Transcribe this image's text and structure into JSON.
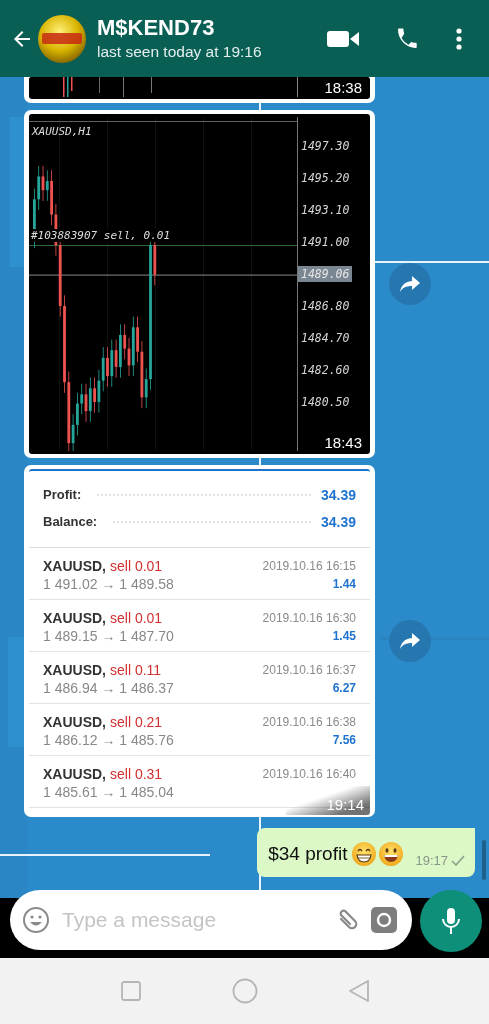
{
  "header": {
    "title": "M$KEND73",
    "status": "last seen today at 19:16"
  },
  "messages": [
    {
      "kind": "chart_tail",
      "time": "18:38"
    },
    {
      "kind": "chart",
      "time": "18:43",
      "forward": true,
      "chart": {
        "title": "XAUUSD,H1",
        "order_label": "#103883907 sell, 0.01",
        "axis_labels": [
          {
            "text": "1497.30",
            "current": false
          },
          {
            "text": "1495.20",
            "current": false
          },
          {
            "text": "1493.10",
            "current": false
          },
          {
            "text": "1491.00",
            "current": false
          },
          {
            "text": "1489.06",
            "current": true
          },
          {
            "text": "1486.80",
            "current": false
          },
          {
            "text": "1484.70",
            "current": false
          },
          {
            "text": "1482.60",
            "current": false
          },
          {
            "text": "1480.50",
            "current": false
          }
        ]
      }
    },
    {
      "kind": "report",
      "time": "19:14",
      "forward": true,
      "summary": [
        {
          "label": "Profit:",
          "value": "34.39"
        },
        {
          "label": "Balance:",
          "value": "34.39"
        }
      ],
      "trades": [
        {
          "symbol": "XAUUSD,",
          "side": "sell 0.01",
          "prices": "1 491.02 → 1 489.58",
          "date": "2019.10.16 16:15",
          "profit": "1.44"
        },
        {
          "symbol": "XAUUSD,",
          "side": "sell 0.01",
          "prices": "1 489.15 → 1 487.70",
          "date": "2019.10.16 16:30",
          "profit": "1.45"
        },
        {
          "symbol": "XAUUSD,",
          "side": "sell 0.11",
          "prices": "1 486.94 → 1 486.37",
          "date": "2019.10.16 16:37",
          "profit": "6.27"
        },
        {
          "symbol": "XAUUSD,",
          "side": "sell 0.21",
          "prices": "1 486.12 → 1 485.76",
          "date": "2019.10.16 16:38",
          "profit": "7.56"
        },
        {
          "symbol": "XAUUSD,",
          "side": "sell 0.31",
          "prices": "1 485.61 → 1 485.04",
          "date": "2019.10.16 16:40"
        }
      ]
    },
    {
      "kind": "text",
      "text": "$34 profit",
      "time": "19:17",
      "sent": true
    }
  ],
  "composer": {
    "placeholder": "Type a message"
  }
}
